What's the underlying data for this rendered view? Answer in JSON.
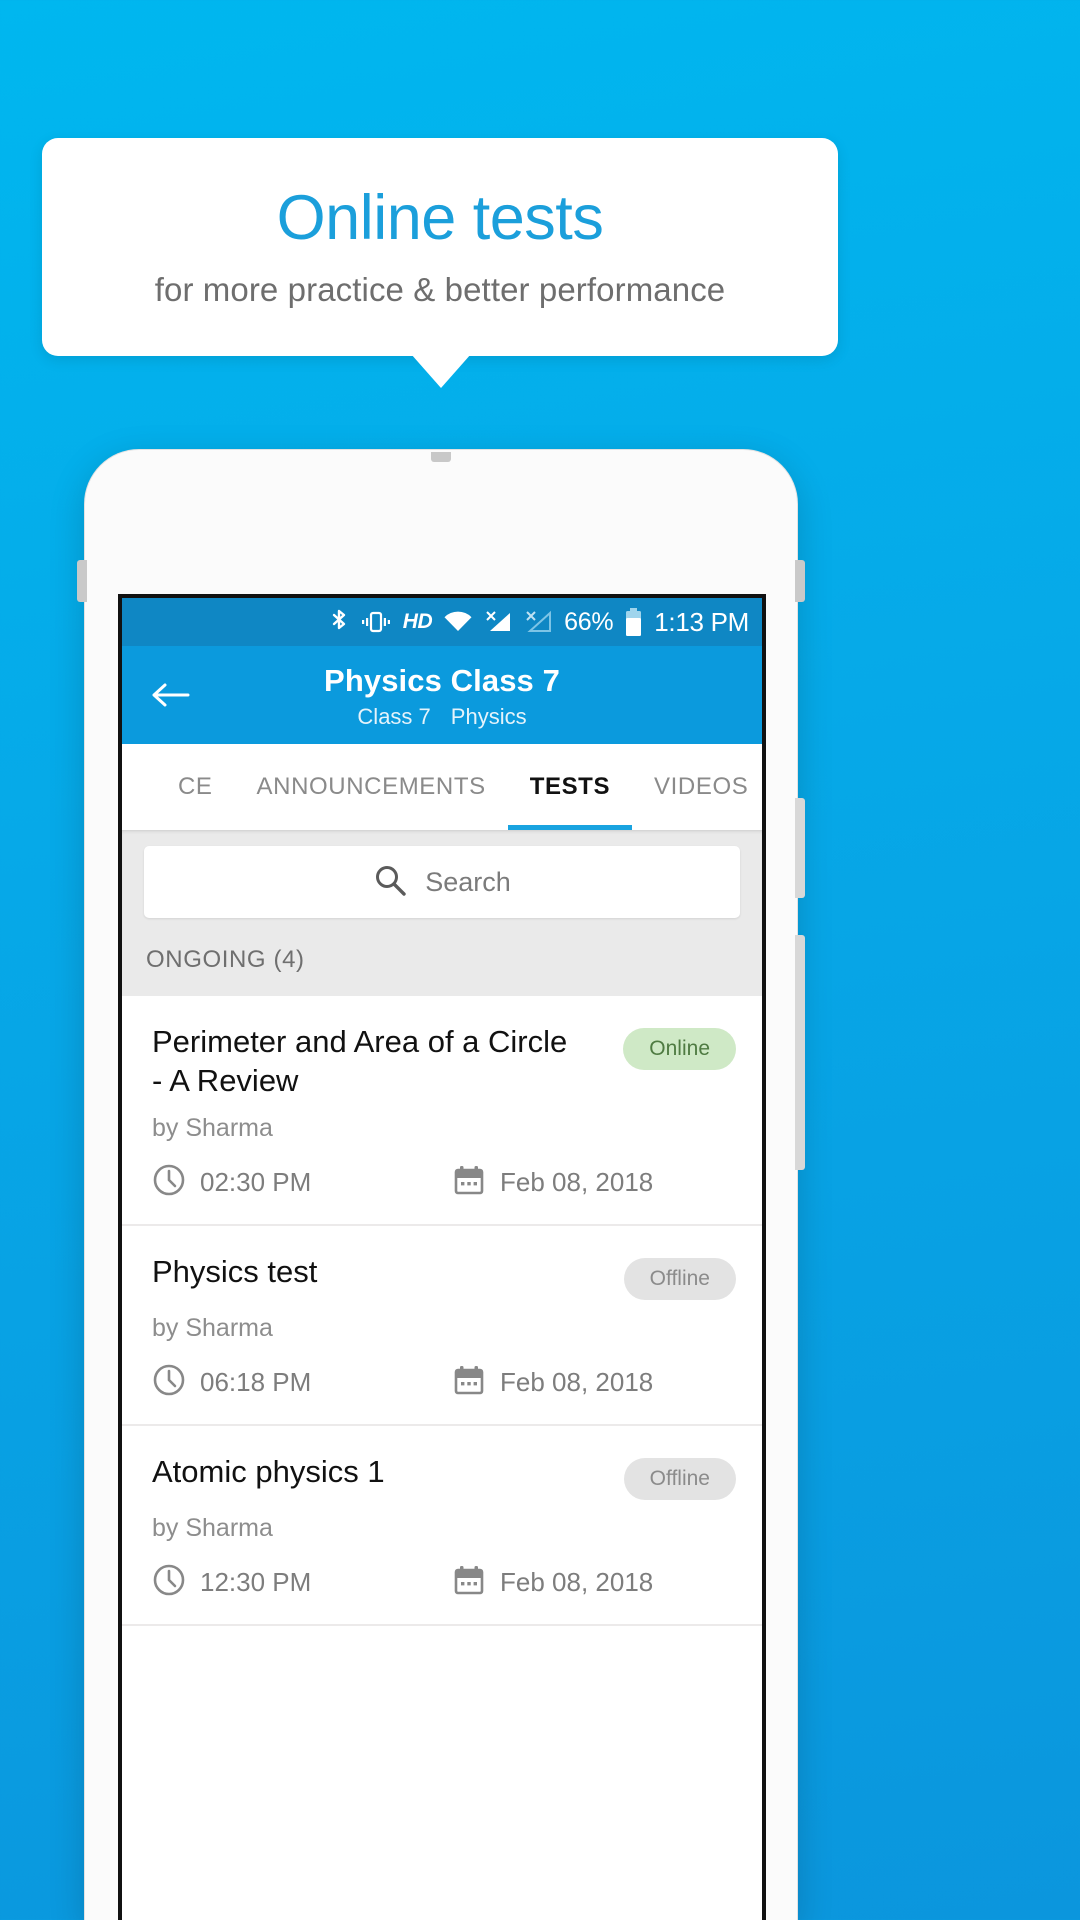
{
  "promo": {
    "title": "Online tests",
    "subtitle": "for more practice & better performance",
    "title_color": "#1b9fdb",
    "background_color": "#00b7ef"
  },
  "status_bar": {
    "icons": [
      "bluetooth-icon",
      "vibrate-icon",
      "hd-icon",
      "wifi-icon",
      "signal-no-sim-1-icon",
      "signal-no-sim-2-icon"
    ],
    "hd_label": "HD",
    "battery_percent": "66%",
    "time": "1:13 PM"
  },
  "app_bar": {
    "back_icon": "back-arrow-icon",
    "title": "Physics Class 7",
    "subtitle_class": "Class 7",
    "subtitle_subject": "Physics",
    "background_color": "#0b9add"
  },
  "tabs": {
    "items": [
      {
        "label": "CE",
        "active": false
      },
      {
        "label": "ANNOUNCEMENTS",
        "active": false
      },
      {
        "label": "TESTS",
        "active": true
      },
      {
        "label": "VIDEOS",
        "active": false
      }
    ],
    "indicator_color": "#19a3e0"
  },
  "search": {
    "icon": "search-icon",
    "placeholder": "Search",
    "value": ""
  },
  "section": {
    "label": "ONGOING (4)"
  },
  "tests": [
    {
      "title": "Perimeter and Area of a Circle - A Review",
      "author": "by Sharma",
      "status": "Online",
      "status_type": "online",
      "time": "02:30 PM",
      "date": "Feb 08, 2018"
    },
    {
      "title": "Physics test",
      "author": "by Sharma",
      "status": "Offline",
      "status_type": "offline",
      "time": "06:18 PM",
      "date": "Feb 08, 2018"
    },
    {
      "title": "Atomic physics 1",
      "author": "by Sharma",
      "status": "Offline",
      "status_type": "offline",
      "time": "12:30 PM",
      "date": "Feb 08, 2018"
    }
  ],
  "icons": {
    "clock": "clock-icon",
    "calendar": "calendar-icon"
  }
}
